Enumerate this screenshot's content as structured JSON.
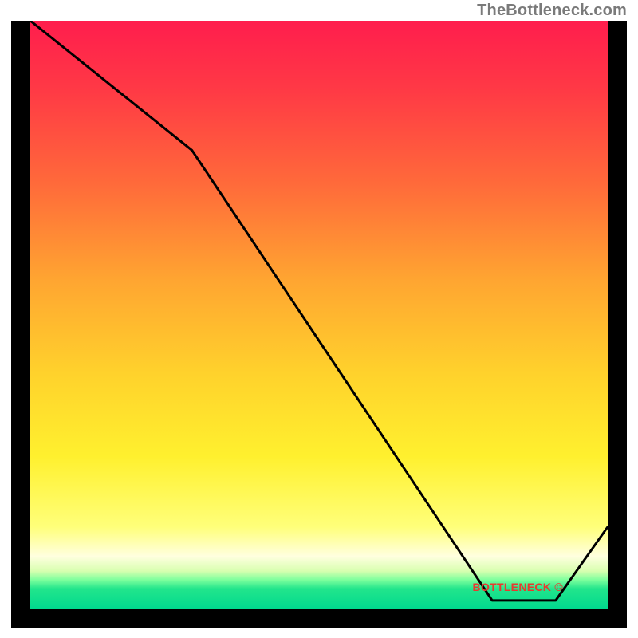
{
  "attribution": "TheBottleneck.com",
  "watermark": "BOTTLENECK ©",
  "chart_data": {
    "type": "line",
    "title": "",
    "xlabel": "",
    "ylabel": "",
    "xlim": [
      0,
      100
    ],
    "ylim": [
      0,
      100
    ],
    "series": [
      {
        "name": "bottleneck-curve",
        "x": [
          0,
          28,
          80,
          91,
          100
        ],
        "values": [
          100,
          78,
          1.5,
          1.5,
          14
        ]
      }
    ],
    "background": "heat-gradient (green=low bottleneck near bottom, red=high bottleneck near top)",
    "annotations": [
      {
        "text": "BOTTLENECK ©",
        "x": 84,
        "y": 3
      }
    ]
  }
}
